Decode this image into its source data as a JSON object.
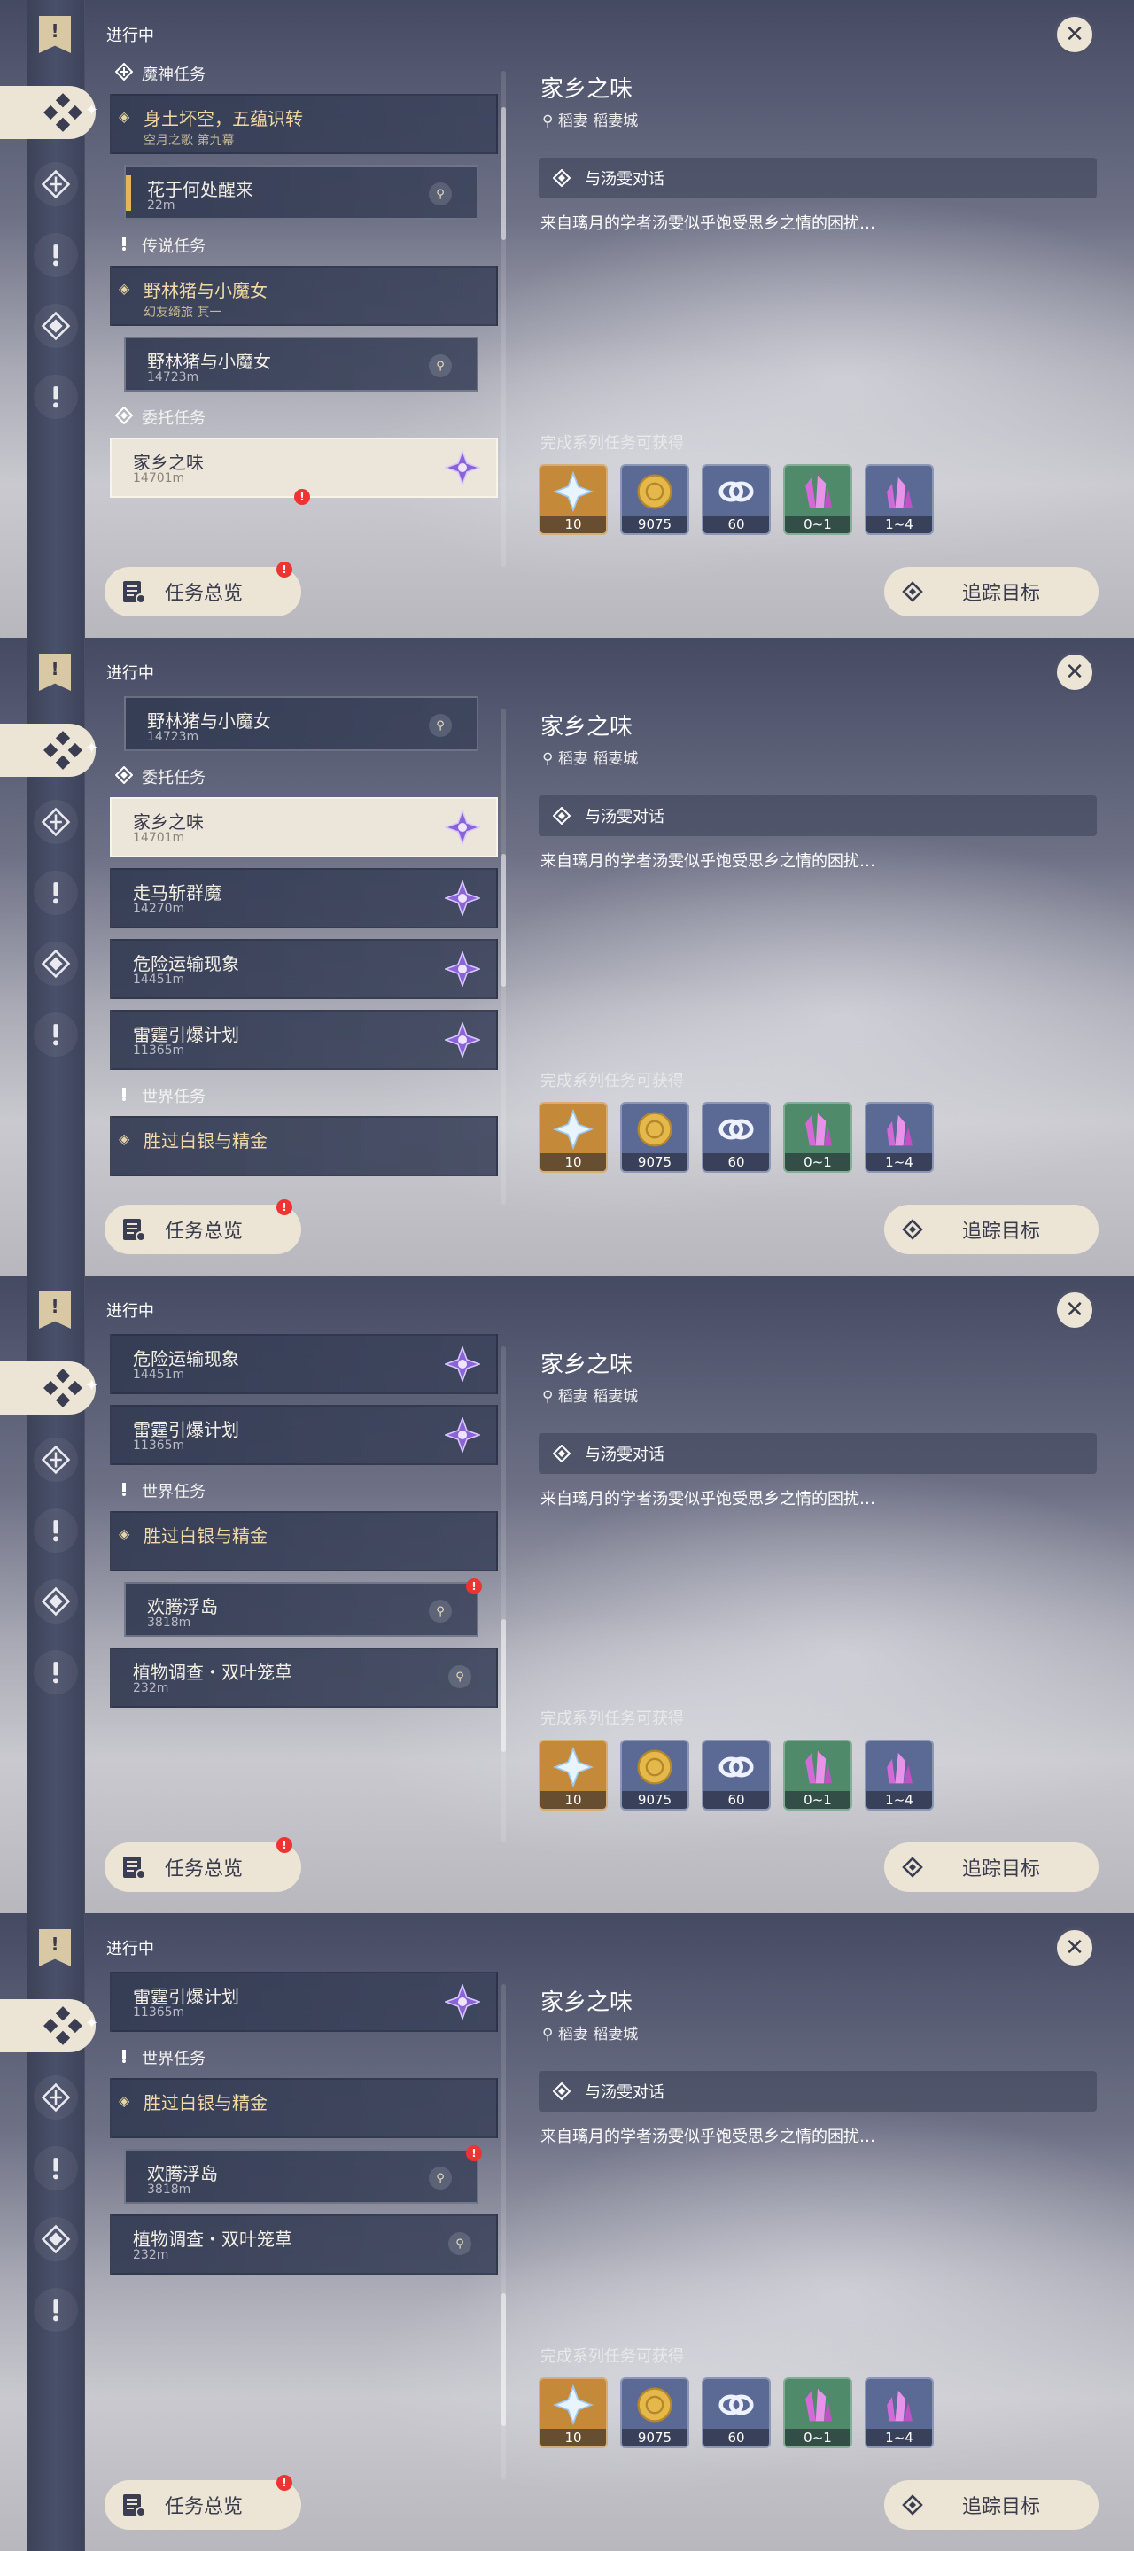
{
  "shared": {
    "list_title": "进行中",
    "overview_label": "任务总览",
    "track_label": "追踪目标",
    "detail": {
      "title": "家乡之味",
      "location": "稻妻 稻妻城",
      "objective": "与汤雯对话",
      "description": "来自璃月的学者汤雯似乎饱受思乡之情的困扰…",
      "rewards_label": "完成系列任务可获得",
      "rewards": [
        {
          "name": "primogem",
          "qty": "10",
          "bg": "#c48a3a"
        },
        {
          "name": "mora",
          "qty": "9075",
          "bg": "#5b6a95"
        },
        {
          "name": "fetter-exp",
          "qty": "60",
          "bg": "#5b6a95"
        },
        {
          "name": "crystal",
          "qty": "0~1",
          "bg": "#4f8a6a"
        },
        {
          "name": "crystal-cluster",
          "qty": "1~4",
          "bg": "#5b6a95"
        }
      ]
    }
  },
  "panels": [
    {
      "scroll": 0.1,
      "rows": [
        {
          "kind": "cat",
          "icon": "archon-icon",
          "label": "魔神任务"
        },
        {
          "kind": "item",
          "style": "main",
          "title": "身土坏空，五蕴识转",
          "sub": "空月之歌 第九幕",
          "badge": "none"
        },
        {
          "kind": "item",
          "style": "inner-prog",
          "title": "花于何处醒来",
          "sub": "22m",
          "badge": "pin"
        },
        {
          "kind": "cat",
          "icon": "legend-icon",
          "label": "传说任务"
        },
        {
          "kind": "item",
          "style": "main",
          "title": "野林猪与小魔女",
          "sub": "幻友绮旅 其一",
          "badge": "none"
        },
        {
          "kind": "item",
          "style": "inner",
          "title": "野林猪与小魔女",
          "sub": "14723m",
          "badge": "pin"
        },
        {
          "kind": "cat",
          "icon": "commission-icon",
          "label": "委托任务"
        },
        {
          "kind": "item",
          "style": "light",
          "title": "家乡之味",
          "sub": "14701m",
          "badge": "star",
          "red": true
        }
      ]
    },
    {
      "scroll": 0.4,
      "rows": [
        {
          "kind": "item",
          "style": "inner",
          "title": "野林猪与小魔女",
          "sub": "14723m",
          "badge": "pin"
        },
        {
          "kind": "cat",
          "icon": "commission-icon",
          "label": "委托任务"
        },
        {
          "kind": "item",
          "style": "light",
          "title": "家乡之味",
          "sub": "14701m",
          "badge": "star"
        },
        {
          "kind": "item",
          "style": "plain",
          "title": "走马斩群魔",
          "sub": "14270m",
          "badge": "star"
        },
        {
          "kind": "item",
          "style": "plain",
          "title": "危险运输现象",
          "sub": "14451m",
          "badge": "star"
        },
        {
          "kind": "item",
          "style": "plain",
          "title": "雷霆引爆计划",
          "sub": "11365m",
          "badge": "star"
        },
        {
          "kind": "cat",
          "icon": "world-icon",
          "label": "世界任务"
        },
        {
          "kind": "item",
          "style": "main",
          "title": "胜过白银与精金",
          "sub": "",
          "badge": "none"
        }
      ]
    },
    {
      "scroll": 0.75,
      "rows": [
        {
          "kind": "item",
          "style": "plain",
          "title": "危险运输现象",
          "sub": "14451m",
          "badge": "star"
        },
        {
          "kind": "item",
          "style": "plain",
          "title": "雷霆引爆计划",
          "sub": "11365m",
          "badge": "star"
        },
        {
          "kind": "cat",
          "icon": "world-icon",
          "label": "世界任务"
        },
        {
          "kind": "item",
          "style": "main",
          "title": "胜过白银与精金",
          "sub": "",
          "badge": "none"
        },
        {
          "kind": "item",
          "style": "inner",
          "title": "欢腾浮岛",
          "sub": "3818m",
          "badge": "pin",
          "red": true
        },
        {
          "kind": "item",
          "style": "plain",
          "title": "植物调查・双叶笼草",
          "sub": "232m",
          "badge": "pin"
        }
      ]
    },
    {
      "scroll": 0.85,
      "rows": [
        {
          "kind": "item",
          "style": "plain",
          "title": "雷霆引爆计划",
          "sub": "11365m",
          "badge": "star"
        },
        {
          "kind": "cat",
          "icon": "world-icon",
          "label": "世界任务"
        },
        {
          "kind": "item",
          "style": "main",
          "title": "胜过白银与精金",
          "sub": "",
          "badge": "none"
        },
        {
          "kind": "item",
          "style": "inner",
          "title": "欢腾浮岛",
          "sub": "3818m",
          "badge": "pin",
          "red": true
        },
        {
          "kind": "item",
          "style": "plain",
          "title": "植物调查・双叶笼草",
          "sub": "232m",
          "badge": "pin"
        }
      ]
    }
  ]
}
